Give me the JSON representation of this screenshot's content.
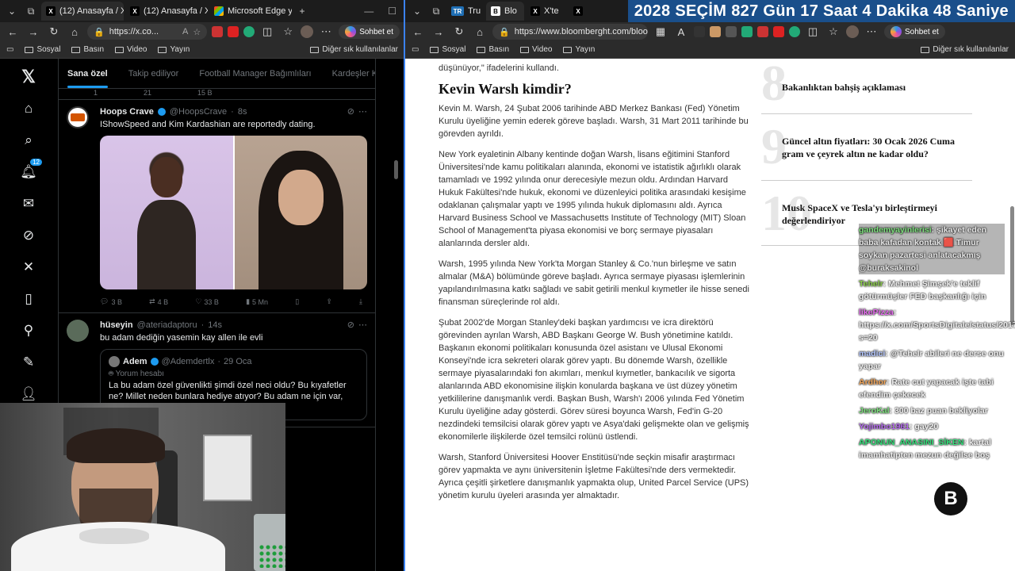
{
  "left_window": {
    "tabs": [
      {
        "title": "(12) Anasayfa / X",
        "favicon": "X"
      },
      {
        "title": "(12) Anasayfa / X",
        "favicon": "X"
      },
      {
        "title": "Microsoft Edge ya",
        "favicon": "MS"
      }
    ],
    "url": "https://x.co...",
    "copilot": "Sohbet et",
    "bookmarks": [
      "Sosyal",
      "Basın",
      "Video",
      "Yayın"
    ],
    "bookmarks_other": "Diğer sık kullanılanlar"
  },
  "x": {
    "sidebar_icons": [
      "x-logo-icon",
      "home-icon",
      "search-icon",
      "notifications-icon",
      "messages-icon",
      "grok-icon",
      "x-premium-icon",
      "bookmarks-icon",
      "communities-icon",
      "compose-icon",
      "profile-icon"
    ],
    "notif_count": "12",
    "feed_tabs": [
      "Sana özel",
      "Takip ediliyor",
      "Football Manager Bağımlıları",
      "Kardeşler Kıraath"
    ],
    "prev_stats": [
      "1",
      "21",
      "15 B"
    ],
    "tweet1": {
      "name": "Hoops Crave",
      "handle": "@HoopsCrave",
      "time": "8s",
      "text": "IShowSpeed and Kim Kardashian are reportedly dating.",
      "replies": "3 B",
      "reposts": "4 B",
      "likes": "33 B",
      "views": "5 Mn"
    },
    "tweet2": {
      "name": "hüseyin",
      "handle": "@ateriadaptoru",
      "time": "14s",
      "text": "bu adam dediğin yasemin kay allen ile evli",
      "quote": {
        "name": "Adem",
        "handle": "@Ademdertlx",
        "time": "29 Oca",
        "tag": "Yorum hesabı",
        "text": "La bu adam özel güvenlikti şimdi özel neci oldu? Bu kıyafetler ne? Millet neden bunlara hediye atıyor? Bu adam ne için var, aklım almıyor. Abi",
        "text_cont": "ran başında tutuyor? Bana"
      }
    }
  },
  "right_window": {
    "tabs": [
      {
        "title": "Tru",
        "favicon": "TR"
      },
      {
        "title": "Blo",
        "favicon": "B"
      },
      {
        "title": "X'te",
        "favicon": "X"
      },
      {
        "title": "",
        "favicon": "X"
      }
    ],
    "countdown": [
      "2028",
      "SEÇİM",
      "827 Gün",
      "17 Saat",
      "4 Dakika",
      "48 Saniye"
    ],
    "url": "https://www.bloomberght.com/bloomb...",
    "copilot": "Sohbet et",
    "bookmarks": [
      "Sosyal",
      "Basın",
      "Video",
      "Yayın"
    ],
    "bookmarks_other": "Diğer sık kullanılanlar"
  },
  "article": {
    "lead_tail": "düşünüyor,\" ifadelerini kullandı.",
    "heading": "Kevin Warsh kimdir?",
    "paragraphs": [
      "Kevin M. Warsh, 24 Şubat 2006 tarihinde ABD Merkez Bankası (Fed) Yönetim Kurulu üyeliğine yemin ederek göreve başladı. Warsh, 31 Mart 2011 tarihinde bu görevden ayrıldı.",
      "New York eyaletinin Albany kentinde doğan Warsh, lisans eğitimini Stanford Üniversitesi'nde kamu politikaları alanında, ekonomi ve istatistik ağırlıklı olarak tamamladı ve 1992 yılında onur derecesiyle mezun oldu. Ardından Harvard Hukuk Fakültesi'nde hukuk, ekonomi ve düzenleyici politika arasındaki kesişime odaklanan çalışmalar yaptı ve 1995 yılında hukuk diplomasını aldı. Ayrıca Harvard Business School ve Massachusetts Institute of Technology (MIT) Sloan School of Management'ta piyasa ekonomisi ve borç sermaye piyasaları alanlarında dersler aldı.",
      "Warsh, 1995 yılında New York'ta Morgan Stanley & Co.'nun birleşme ve satın almalar (M&A) bölümünde göreve başladı. Ayrıca sermaye piyasası işlemlerinin yapılandırılmasına katkı sağladı ve sabit getirili menkul kıymetler ile hisse senedi finansman süreçlerinde rol aldı.",
      "Şubat 2002'de Morgan Stanley'deki başkan yardımcısı ve icra direktörü görevinden ayrılan Warsh, ABD Başkanı George W. Bush yönetimine katıldı. Başkanın ekonomi politikaları konusunda özel asistanı ve Ulusal Ekonomi Konseyi'nde icra sekreteri olarak görev yaptı. Bu dönemde Warsh, özellikle sermaye piyasalarındaki fon akımları, menkul kıymetler, bankacılık ve sigorta alanlarında ABD ekonomisine ilişkin konularda başkana ve üst düzey yönetim yetkililerine danışmanlık verdi. Başkan Bush, Warsh'ı 2006 yılında Fed Yönetim Kurulu üyeliğine aday gösterdi. Görev süresi boyunca Warsh, Fed'in G-20 nezdindeki temsilcisi olarak görev yaptı ve Asya'daki gelişmekte olan ve gelişmiş ekonomilerle ilişkilerde özel temsilci rolünü üstlendi.",
      "Warsh, Stanford Üniversitesi Hoover Enstitüsü'nde seçkin misafir araştırmacı görev yapmakta ve aynı üniversitenin İşletme Fakültesi'nde ders vermektedir. Ayrıca çeşitli şirketlere danışmanlık yapmakta olup, United Parcel Service (UPS) yönetim kurulu üyeleri arasında yer almaktadır."
    ]
  },
  "rail": [
    {
      "num": "8",
      "title": "Bakanlıktan bahşiş açıklaması"
    },
    {
      "num": "9",
      "title": "Güncel altın fiyatları: 30 Ocak 2026 Cuma gram ve çeyrek altın ne kadar oldu?"
    },
    {
      "num": "10",
      "title": "Musk SpaceX ve Tesla'yı birleştirmeyi değerlendiriyor"
    }
  ],
  "chat": [
    {
      "user": "gandemyayinlerisi",
      "text": ": şikayet eden baba kafadan kontak 🟥 Timur soykan pazartesi anlatacakmış @buraksakinol",
      "color": "#7ee07e"
    },
    {
      "user": "Tehelr",
      "text": ": Mehmet Şimşek'e teklif götürmüşler FED başkanlığı için",
      "color": "#8fd14f"
    },
    {
      "user": "likePizza",
      "text": ": https://x.com/SportsDigitale/status/2017197701197168934?s=20",
      "color": "#e76cf0"
    },
    {
      "user": "madici",
      "text": ": @Tehelr abileri ne derse onu yapar",
      "color": "#b4c7ff"
    },
    {
      "user": "Ardhor",
      "text": ": Rate cut yapacak işte tabi efendim çekecek",
      "color": "#f2a65a"
    },
    {
      "user": "JeroKal",
      "text": ": 300 baz puan bekliyolar",
      "color": "#7ee07e"
    },
    {
      "user": "Yojimbo1961",
      "text": ": gay20",
      "color": "#b76cf0"
    },
    {
      "user": "APONUN_ANASINI_SİKEN",
      "text": ": kartal imamhatipten mezun değilse boş",
      "color": "#35e07b"
    }
  ],
  "colors": {
    "accent": "#1d9bf0",
    "countdown_bg": "#1a4f8b"
  }
}
